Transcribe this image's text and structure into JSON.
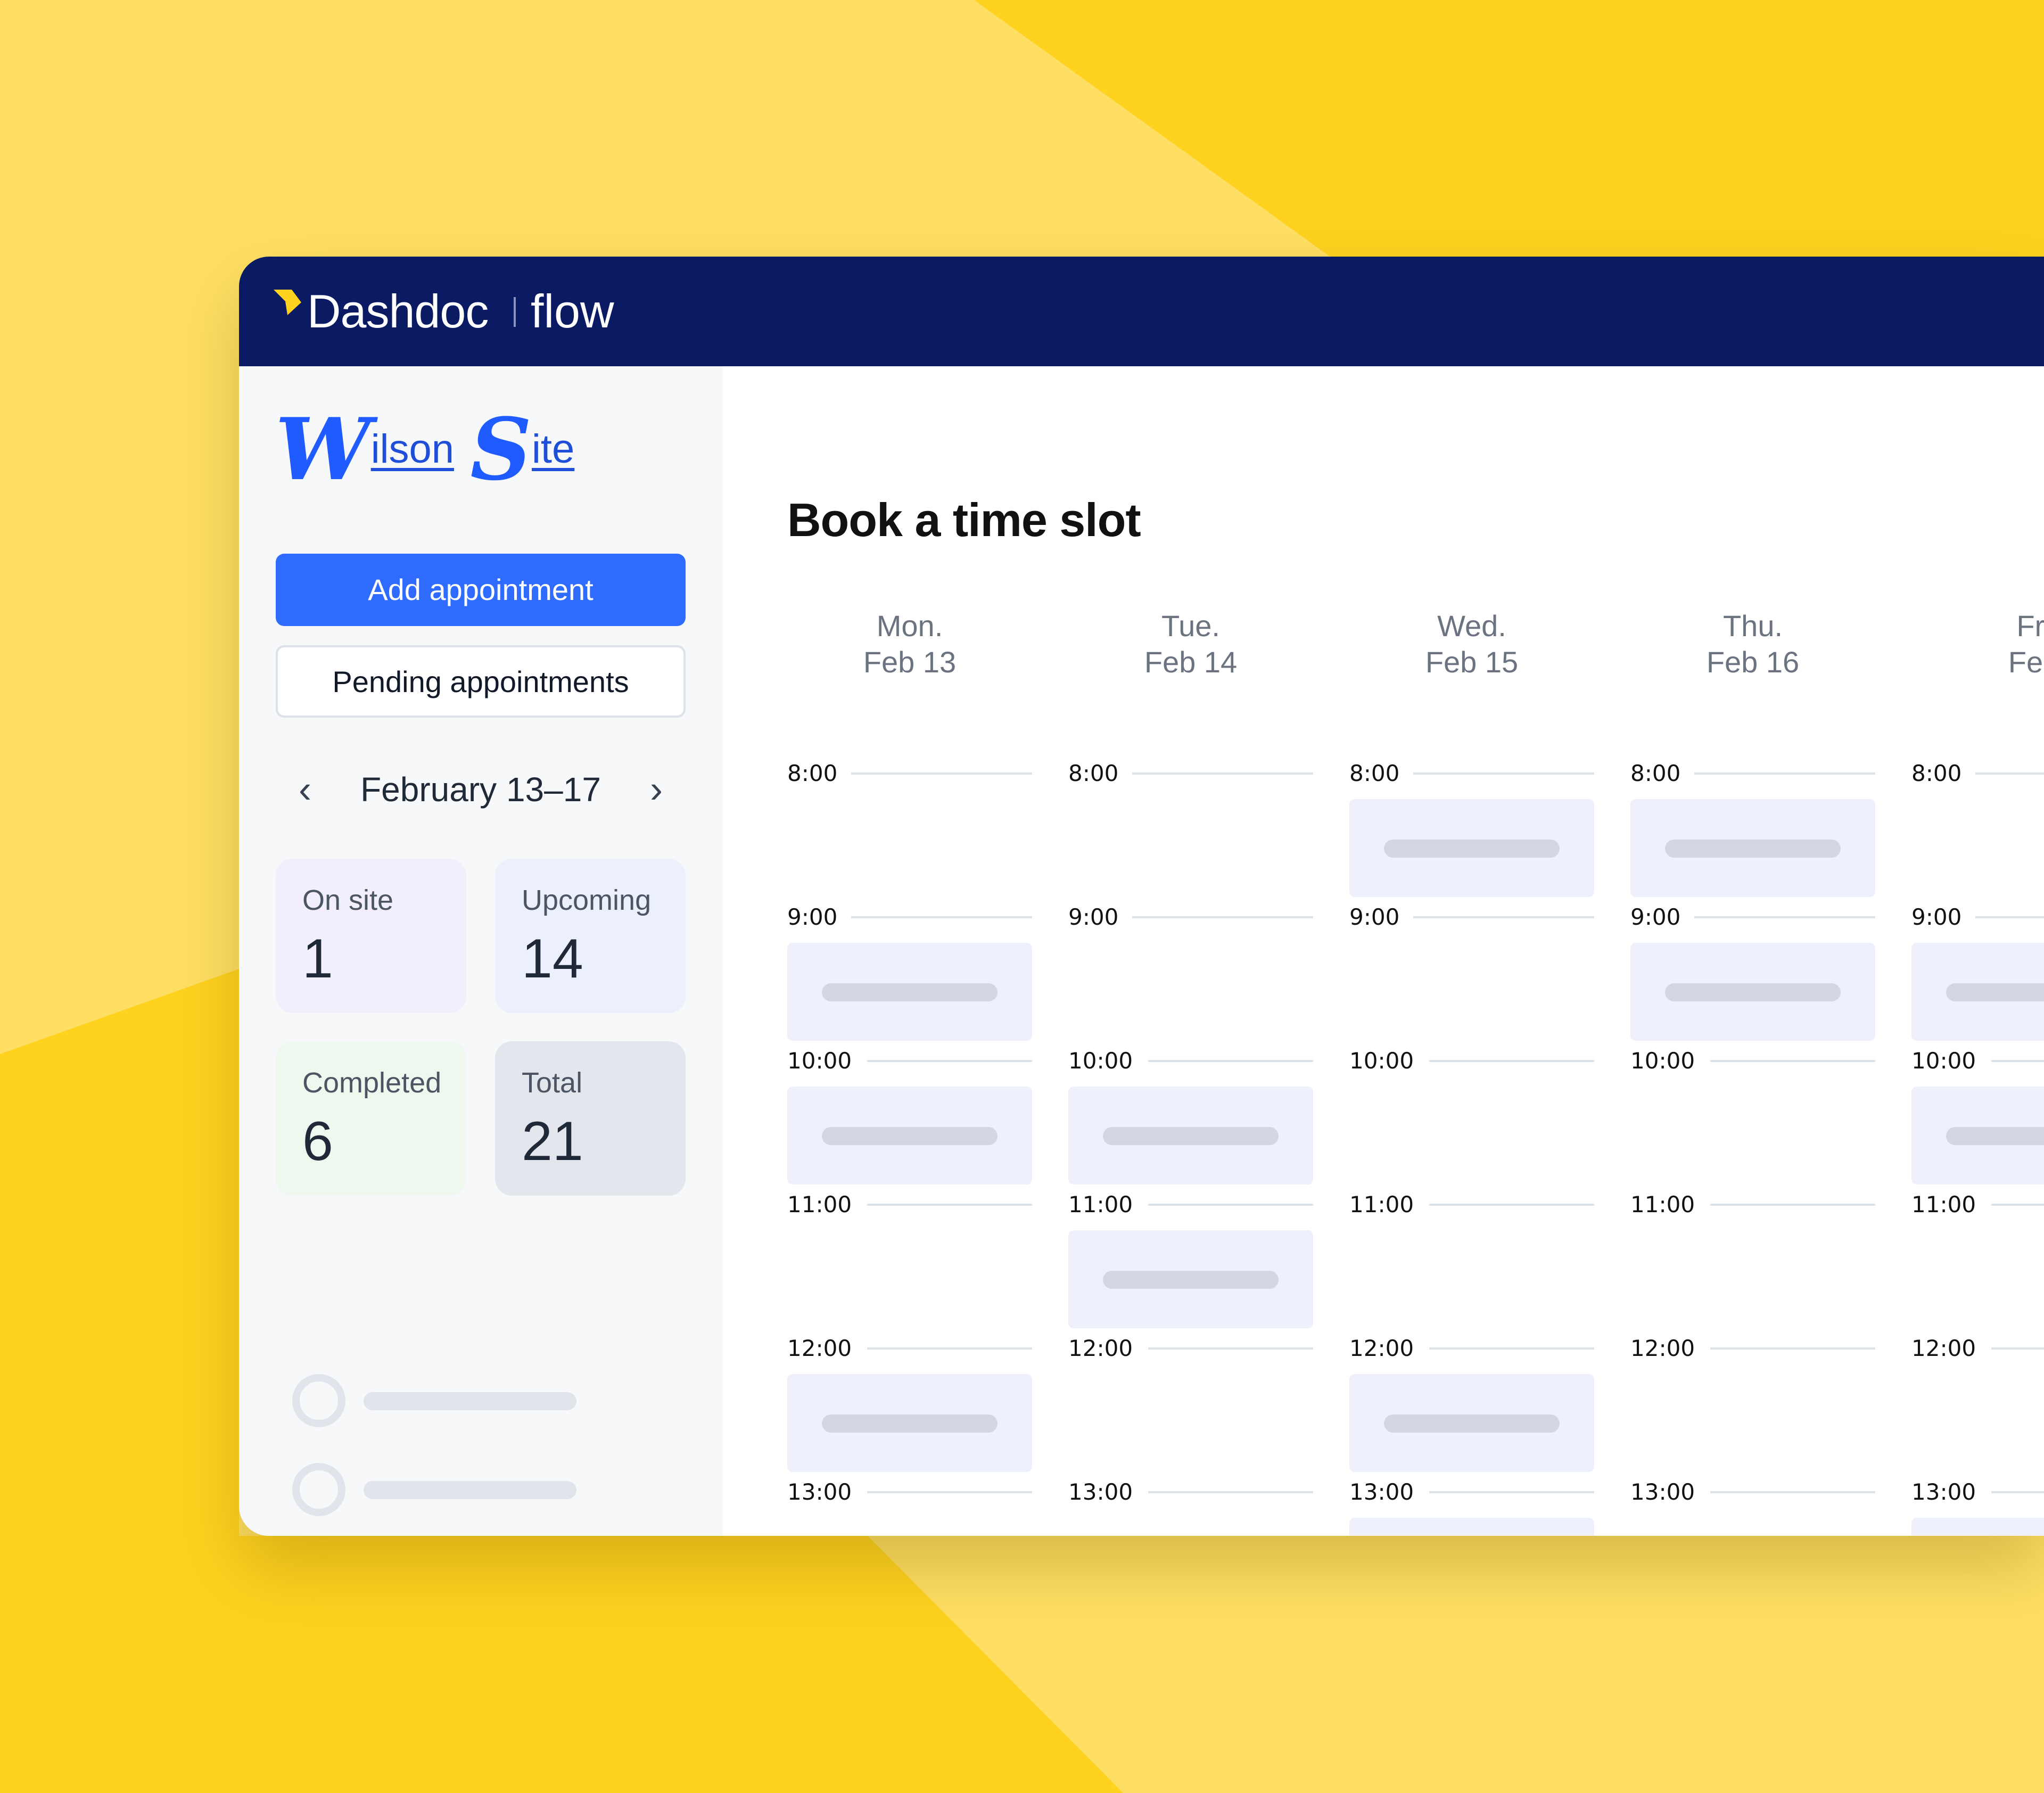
{
  "header": {
    "brand": "Dashdoc",
    "product": "flow"
  },
  "sidebar": {
    "site_logo": {
      "w_initial": "W",
      "w_rest": "ilson",
      "s_initial": "S",
      "s_rest": "ite"
    },
    "add_appointment_label": "Add appointment",
    "pending_appointments_label": "Pending appointments",
    "week_range": "February 13–17",
    "prev_icon": "‹",
    "next_icon": "›",
    "stats": {
      "on_site": {
        "label": "On site",
        "value": "1"
      },
      "upcoming": {
        "label": "Upcoming",
        "value": "14"
      },
      "completed": {
        "label": "Completed",
        "value": "6"
      },
      "total": {
        "label": "Total",
        "value": "21"
      }
    }
  },
  "main": {
    "title": "Book a time slot",
    "days": [
      {
        "day": "Mon.",
        "date": "Feb 13"
      },
      {
        "day": "Tue.",
        "date": "Feb 14"
      },
      {
        "day": "Wed.",
        "date": "Feb 15"
      },
      {
        "day": "Thu.",
        "date": "Feb 16"
      },
      {
        "day": "Fri",
        "date": "Feb"
      }
    ],
    "hours": [
      "8:00",
      "9:00",
      "10:00",
      "11:00",
      "12:00",
      "13:00"
    ]
  },
  "colors": {
    "topbar": "#0A1A63",
    "accent": "#2F6BFF",
    "background_yellow": "#FED21F",
    "background_light_yellow": "#FEDF63"
  }
}
